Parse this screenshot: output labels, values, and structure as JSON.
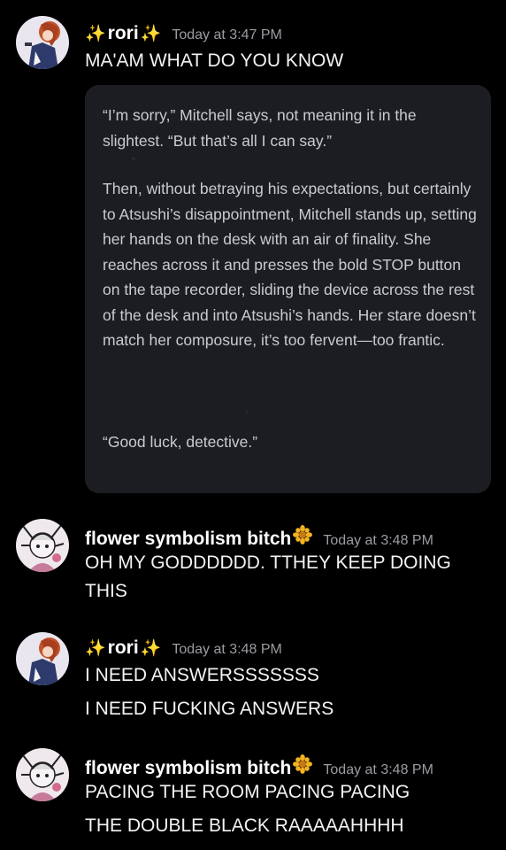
{
  "messages": [
    {
      "username": "rori",
      "username_decoration": "✨",
      "timestamp": "Today at 3:47 PM",
      "lines": [
        "MA'AM WHAT DO YOU KNOW"
      ],
      "embed": {
        "paragraphs": [
          "“I’m sorry,” Mitchell says, not meaning it in the slightest. “But that’s all I can say.”",
          "Then, without betraying his expectations, but certainly to Atsushi’s disappointment, Mitchell stands up, setting her hands on the desk with an air of finality. She reaches across it and presses the bold STOP button on the tape recorder, sliding the device across the rest of the desk and into Atsushi’s hands. Her stare doesn’t match her composure, it’s too fervent—too frantic.",
          "“Good luck, detective.”"
        ]
      }
    },
    {
      "username": "flower symbolism bitch",
      "timestamp": "Today at 3:48 PM",
      "lines": [
        "OH MY GODDDDDD. TTHEY KEEP DOING THIS"
      ]
    },
    {
      "username": "rori",
      "username_decoration": "✨",
      "timestamp": "Today at 3:48 PM",
      "lines": [
        "I NEED ANSWERSSSSSSS",
        "I NEED FUCKING ANSWERS"
      ]
    },
    {
      "username": "flower symbolism bitch",
      "timestamp": "Today at 3:48 PM",
      "lines": [
        "PACING THE ROOM PACING PACING",
        "THE DOUBLE BLACK RAAAAAHHHH"
      ]
    }
  ],
  "icons": {
    "username_sparkles": "sparkles-icon",
    "username_flower": "sunflower-icon"
  },
  "colors": {
    "background": "#000000",
    "embed_background": "#1c1d22",
    "timestamp": "#9a9ca3",
    "sparkle": "#f7c548",
    "flower": "#f2b321"
  }
}
